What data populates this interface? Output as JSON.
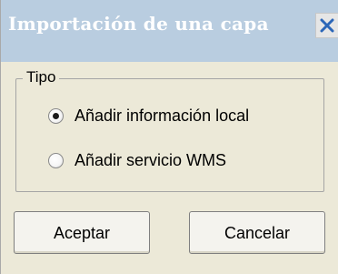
{
  "window": {
    "title": "Importación de una capa",
    "close_icon": "close-icon"
  },
  "group": {
    "legend": "Tipo",
    "options": [
      {
        "label": "Añadir información local",
        "selected": true
      },
      {
        "label": "Añadir servicio WMS",
        "selected": false
      }
    ]
  },
  "buttons": {
    "ok_label": "Aceptar",
    "cancel_label": "Cancelar"
  },
  "colors": {
    "title_bar": "#b9cde0",
    "dialog_background": "#ece9d8"
  }
}
